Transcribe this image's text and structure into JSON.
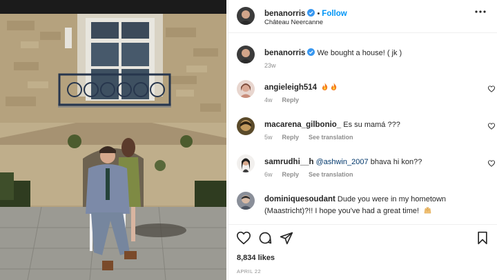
{
  "post": {
    "username": "benanorris",
    "follow_label": "Follow",
    "separator": "•",
    "location": "Château Neercanne",
    "caption_text": "We bought a house! ( jk )",
    "caption_age": "23w",
    "likes": "8,834 likes",
    "date": "APRIL 22"
  },
  "comments": [
    {
      "username": "angieleigh514",
      "text": "",
      "emoji": [
        "fire",
        "fire"
      ],
      "age": "4w",
      "reply": "Reply",
      "translation": ""
    },
    {
      "username": "macarena_gilbonio_",
      "text": "Es su mamá ???",
      "age": "5w",
      "reply": "Reply",
      "translation": "See translation"
    },
    {
      "username": "samrudhi__h",
      "mention": "@ashwin_2007",
      "text": "bhava hi kon??",
      "age": "6w",
      "reply": "Reply",
      "translation": "See translation"
    },
    {
      "username": "dominiquesoudant",
      "text": "Dude you were in my hometown (Maastricht)?!! I hope you've had a great time!",
      "emoji": [
        "hands"
      ]
    }
  ],
  "icons": {
    "verified": "verified-badge-icon",
    "more": "more-options-icon",
    "like": "heart-icon",
    "comment": "comment-icon",
    "share": "share-icon",
    "save": "bookmark-icon"
  },
  "colors": {
    "accent": "#0095f6",
    "text": "#262626",
    "muted": "#8e8e8e",
    "verified": "#3897f0"
  }
}
